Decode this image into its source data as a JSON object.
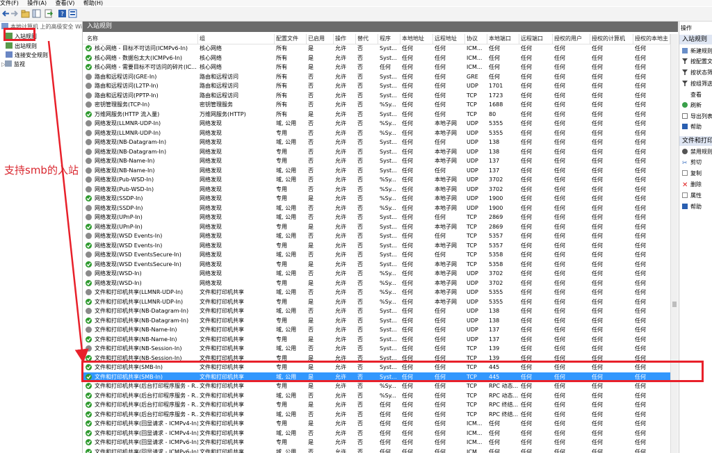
{
  "menu": [
    "文件(F)",
    "操作(A)",
    "查看(V)",
    "帮助(H)"
  ],
  "tree": {
    "root": "本地计算机 上的高级安全 Wi",
    "items": [
      "入站规则",
      "出站规则",
      "连接安全规则",
      "监视"
    ]
  },
  "pane_title": "入站规则",
  "columns": [
    "名称",
    "组",
    "配置文件",
    "已启用",
    "操作",
    "替代",
    "程序",
    "本地地址",
    "远程地址",
    "协议",
    "本地端口",
    "远程端口",
    "授权的用户",
    "授权的计算机",
    "授权的本地主"
  ],
  "rows": [
    {
      "s": "en",
      "c": [
        "核心网络 - 目标不可访问(ICMPv6-In)",
        "核心网络",
        "所有",
        "是",
        "允许",
        "否",
        "Syst...",
        "任何",
        "任何",
        "ICM...",
        "任何",
        "任何",
        "任何",
        "任何",
        "任何"
      ]
    },
    {
      "s": "en",
      "c": [
        "核心网络 - 数据包太大(ICMPv6-In)",
        "核心网络",
        "所有",
        "是",
        "允许",
        "否",
        "Syst...",
        "任何",
        "任何",
        "ICM...",
        "任何",
        "任何",
        "任何",
        "任何",
        "任何"
      ]
    },
    {
      "s": "en",
      "c": [
        "核心网络 - 需要目标不可访问的碎片(IC...",
        "核心网络",
        "所有",
        "是",
        "允许",
        "否",
        "任何",
        "任何",
        "任何",
        "ICM...",
        "任何",
        "任何",
        "任何",
        "任何",
        "任何"
      ]
    },
    {
      "s": "dis",
      "c": [
        "路由和远程访问(GRE-In)",
        "路由和远程访问",
        "所有",
        "否",
        "允许",
        "否",
        "Syst...",
        "任何",
        "任何",
        "GRE",
        "任何",
        "任何",
        "任何",
        "任何",
        "任何"
      ]
    },
    {
      "s": "dis",
      "c": [
        "路由和远程访问(L2TP-In)",
        "路由和远程访问",
        "所有",
        "否",
        "允许",
        "否",
        "Syst...",
        "任何",
        "任何",
        "UDP",
        "1701",
        "任何",
        "任何",
        "任何",
        "任何"
      ]
    },
    {
      "s": "dis",
      "c": [
        "路由和远程访问(PPTP-In)",
        "路由和远程访问",
        "所有",
        "否",
        "允许",
        "否",
        "Syst...",
        "任何",
        "任何",
        "TCP",
        "1723",
        "任何",
        "任何",
        "任何",
        "任何"
      ]
    },
    {
      "s": "dis",
      "c": [
        "密钥管理服务(TCP-In)",
        "密钥管理服务",
        "所有",
        "否",
        "允许",
        "否",
        "%Sy...",
        "任何",
        "任何",
        "TCP",
        "1688",
        "任何",
        "任何",
        "任何",
        "任何"
      ]
    },
    {
      "s": "en",
      "c": [
        "万维网服务(HTTP 流入量)",
        "万维网服务(HTTP)",
        "所有",
        "是",
        "允许",
        "否",
        "Syst...",
        "任何",
        "任何",
        "TCP",
        "80",
        "任何",
        "任何",
        "任何",
        "任何"
      ]
    },
    {
      "s": "dis",
      "c": [
        "网络发现(LLMNR-UDP-In)",
        "网络发现",
        "域, 公用",
        "否",
        "允许",
        "否",
        "%Sy...",
        "任何",
        "本地子网",
        "UDP",
        "5355",
        "任何",
        "任何",
        "任何",
        "任何"
      ]
    },
    {
      "s": "dis",
      "c": [
        "网络发现(LLMNR-UDP-In)",
        "网络发现",
        "专用",
        "否",
        "允许",
        "否",
        "%Sy...",
        "任何",
        "本地子网",
        "UDP",
        "5355",
        "任何",
        "任何",
        "任何",
        "任何"
      ]
    },
    {
      "s": "dis",
      "c": [
        "网络发现(NB-Datagram-In)",
        "网络发现",
        "域, 公用",
        "否",
        "允许",
        "否",
        "Syst...",
        "任何",
        "任何",
        "UDP",
        "138",
        "任何",
        "任何",
        "任何",
        "任何"
      ]
    },
    {
      "s": "dis",
      "c": [
        "网络发现(NB-Datagram-In)",
        "网络发现",
        "专用",
        "否",
        "允许",
        "否",
        "Syst...",
        "任何",
        "本地子网",
        "UDP",
        "138",
        "任何",
        "任何",
        "任何",
        "任何"
      ]
    },
    {
      "s": "dis",
      "c": [
        "网络发现(NB-Name-In)",
        "网络发现",
        "专用",
        "否",
        "允许",
        "否",
        "Syst...",
        "任何",
        "本地子网",
        "UDP",
        "137",
        "任何",
        "任何",
        "任何",
        "任何"
      ]
    },
    {
      "s": "dis",
      "c": [
        "网络发现(NB-Name-In)",
        "网络发现",
        "域, 公用",
        "否",
        "允许",
        "否",
        "Syst...",
        "任何",
        "任何",
        "UDP",
        "137",
        "任何",
        "任何",
        "任何",
        "任何"
      ]
    },
    {
      "s": "dis",
      "c": [
        "网络发现(Pub-WSD-In)",
        "网络发现",
        "域, 公用",
        "否",
        "允许",
        "否",
        "%Sy...",
        "任何",
        "本地子网",
        "UDP",
        "3702",
        "任何",
        "任何",
        "任何",
        "任何"
      ]
    },
    {
      "s": "dis",
      "c": [
        "网络发现(Pub-WSD-In)",
        "网络发现",
        "专用",
        "否",
        "允许",
        "否",
        "%Sy...",
        "任何",
        "本地子网",
        "UDP",
        "3702",
        "任何",
        "任何",
        "任何",
        "任何"
      ]
    },
    {
      "s": "en",
      "c": [
        "网络发现(SSDP-In)",
        "网络发现",
        "专用",
        "是",
        "允许",
        "否",
        "%Sy...",
        "任何",
        "本地子网",
        "UDP",
        "1900",
        "任何",
        "任何",
        "任何",
        "任何"
      ]
    },
    {
      "s": "dis",
      "c": [
        "网络发现(SSDP-In)",
        "网络发现",
        "域, 公用",
        "否",
        "允许",
        "否",
        "%Sy...",
        "任何",
        "本地子网",
        "UDP",
        "1900",
        "任何",
        "任何",
        "任何",
        "任何"
      ]
    },
    {
      "s": "dis",
      "c": [
        "网络发现(UPnP-In)",
        "网络发现",
        "域, 公用",
        "否",
        "允许",
        "否",
        "Syst...",
        "任何",
        "任何",
        "TCP",
        "2869",
        "任何",
        "任何",
        "任何",
        "任何"
      ]
    },
    {
      "s": "en",
      "c": [
        "网络发现(UPnP-In)",
        "网络发现",
        "专用",
        "是",
        "允许",
        "否",
        "Syst...",
        "任何",
        "本地子网",
        "TCP",
        "2869",
        "任何",
        "任何",
        "任何",
        "任何"
      ]
    },
    {
      "s": "dis",
      "c": [
        "网络发现(WSD Events-In)",
        "网络发现",
        "域, 公用",
        "否",
        "允许",
        "否",
        "Syst...",
        "任何",
        "任何",
        "TCP",
        "5357",
        "任何",
        "任何",
        "任何",
        "任何"
      ]
    },
    {
      "s": "en",
      "c": [
        "网络发现(WSD Events-In)",
        "网络发现",
        "专用",
        "是",
        "允许",
        "否",
        "Syst...",
        "任何",
        "本地子网",
        "TCP",
        "5357",
        "任何",
        "任何",
        "任何",
        "任何"
      ]
    },
    {
      "s": "dis",
      "c": [
        "网络发现(WSD EventsSecure-In)",
        "网络发现",
        "域, 公用",
        "否",
        "允许",
        "否",
        "Syst...",
        "任何",
        "任何",
        "TCP",
        "5358",
        "任何",
        "任何",
        "任何",
        "任何"
      ]
    },
    {
      "s": "en",
      "c": [
        "网络发现(WSD EventsSecure-In)",
        "网络发现",
        "专用",
        "是",
        "允许",
        "否",
        "Syst...",
        "任何",
        "本地子网",
        "TCP",
        "5358",
        "任何",
        "任何",
        "任何",
        "任何"
      ]
    },
    {
      "s": "dis",
      "c": [
        "网络发现(WSD-In)",
        "网络发现",
        "域, 公用",
        "否",
        "允许",
        "否",
        "%Sy...",
        "任何",
        "本地子网",
        "UDP",
        "3702",
        "任何",
        "任何",
        "任何",
        "任何"
      ]
    },
    {
      "s": "en",
      "c": [
        "网络发现(WSD-In)",
        "网络发现",
        "专用",
        "是",
        "允许",
        "否",
        "%Sy...",
        "任何",
        "本地子网",
        "UDP",
        "3702",
        "任何",
        "任何",
        "任何",
        "任何"
      ]
    },
    {
      "s": "dis",
      "c": [
        "文件和打印机共享(LLMNR-UDP-In)",
        "文件和打印机共享",
        "域, 公用",
        "否",
        "允许",
        "否",
        "%Sy...",
        "任何",
        "本地子网",
        "UDP",
        "5355",
        "任何",
        "任何",
        "任何",
        "任何"
      ]
    },
    {
      "s": "en",
      "c": [
        "文件和打印机共享(LLMNR-UDP-In)",
        "文件和打印机共享",
        "专用",
        "是",
        "允许",
        "否",
        "%Sy...",
        "任何",
        "本地子网",
        "UDP",
        "5355",
        "任何",
        "任何",
        "任何",
        "任何"
      ]
    },
    {
      "s": "dis",
      "c": [
        "文件和打印机共享(NB-Datagram-In)",
        "文件和打印机共享",
        "域, 公用",
        "否",
        "允许",
        "否",
        "Syst...",
        "任何",
        "任何",
        "UDP",
        "138",
        "任何",
        "任何",
        "任何",
        "任何"
      ]
    },
    {
      "s": "en",
      "c": [
        "文件和打印机共享(NB-Datagram-In)",
        "文件和打印机共享",
        "专用",
        "是",
        "允许",
        "否",
        "Syst...",
        "任何",
        "任何",
        "UDP",
        "138",
        "任何",
        "任何",
        "任何",
        "任何"
      ]
    },
    {
      "s": "dis",
      "c": [
        "文件和打印机共享(NB-Name-In)",
        "文件和打印机共享",
        "域, 公用",
        "否",
        "允许",
        "否",
        "Syst...",
        "任何",
        "任何",
        "UDP",
        "137",
        "任何",
        "任何",
        "任何",
        "任何"
      ]
    },
    {
      "s": "en",
      "c": [
        "文件和打印机共享(NB-Name-In)",
        "文件和打印机共享",
        "专用",
        "是",
        "允许",
        "否",
        "Syst...",
        "任何",
        "任何",
        "UDP",
        "137",
        "任何",
        "任何",
        "任何",
        "任何"
      ]
    },
    {
      "s": "dis",
      "c": [
        "文件和打印机共享(NB-Session-In)",
        "文件和打印机共享",
        "域, 公用",
        "否",
        "允许",
        "否",
        "Syst...",
        "任何",
        "任何",
        "TCP",
        "139",
        "任何",
        "任何",
        "任何",
        "任何"
      ]
    },
    {
      "s": "en",
      "c": [
        "文件和打印机共享(NB-Session-In)",
        "文件和打印机共享",
        "专用",
        "是",
        "允许",
        "否",
        "Syst...",
        "任何",
        "任何",
        "TCP",
        "139",
        "任何",
        "任何",
        "任何",
        "任何"
      ]
    },
    {
      "s": "en",
      "c": [
        "文件和打印机共享(SMB-In)",
        "文件和打印机共享",
        "专用",
        "是",
        "允许",
        "否",
        "Syst...",
        "任何",
        "任何",
        "TCP",
        "445",
        "任何",
        "任何",
        "任何",
        "任何"
      ]
    },
    {
      "s": "en",
      "sel": true,
      "c": [
        "文件和打印机共享(SMB-In)",
        "文件和打印机共享",
        "域, 公用",
        "是",
        "允许",
        "否",
        "Syst...",
        "任何",
        "任何",
        "TCP",
        "445",
        "任何",
        "任何",
        "任何",
        "任何"
      ]
    },
    {
      "s": "en",
      "c": [
        "文件和打印机共享(后台打印程序服务 - R...",
        "文件和打印机共享",
        "专用",
        "是",
        "允许",
        "否",
        "%Sy...",
        "任何",
        "任何",
        "TCP",
        "RPC 动态...",
        "任何",
        "任何",
        "任何",
        "任何"
      ]
    },
    {
      "s": "en",
      "c": [
        "文件和打印机共享(后台打印程序服务 - R...",
        "文件和打印机共享",
        "域, 公用",
        "否",
        "允许",
        "否",
        "%Sy...",
        "任何",
        "任何",
        "TCP",
        "RPC 动态...",
        "任何",
        "任何",
        "任何",
        "任何"
      ]
    },
    {
      "s": "en",
      "c": [
        "文件和打印机共享(后台打印程序服务 - R...",
        "文件和打印机共享",
        "专用",
        "是",
        "允许",
        "否",
        "任何",
        "任何",
        "任何",
        "TCP",
        "RPC 终结...",
        "任何",
        "任何",
        "任何",
        "任何"
      ]
    },
    {
      "s": "en",
      "c": [
        "文件和打印机共享(后台打印程序服务 - R...",
        "文件和打印机共享",
        "域, 公用",
        "否",
        "允许",
        "否",
        "任何",
        "任何",
        "任何",
        "TCP",
        "RPC 终结...",
        "任何",
        "任何",
        "任何",
        "任何"
      ]
    },
    {
      "s": "en",
      "c": [
        "文件和打印机共享(回显请求 - ICMPv4-In)",
        "文件和打印机共享",
        "专用",
        "是",
        "允许",
        "否",
        "任何",
        "任何",
        "任何",
        "ICM...",
        "任何",
        "任何",
        "任何",
        "任何",
        "任何"
      ]
    },
    {
      "s": "en",
      "c": [
        "文件和打印机共享(回显请求 - ICMPv4-In)",
        "文件和打印机共享",
        "域, 公用",
        "否",
        "允许",
        "否",
        "任何",
        "任何",
        "任何",
        "ICM...",
        "任何",
        "任何",
        "任何",
        "任何",
        "任何"
      ]
    },
    {
      "s": "en",
      "c": [
        "文件和打印机共享(回显请求 - ICMPv6-In)",
        "文件和打印机共享",
        "专用",
        "是",
        "允许",
        "否",
        "任何",
        "任何",
        "任何",
        "ICM...",
        "任何",
        "任何",
        "任何",
        "任何",
        "任何"
      ]
    },
    {
      "s": "en",
      "c": [
        "文件和打印机共享(回显请求 - ICMPv6-In)",
        "文件和打印机共享",
        "域, 公用",
        "否",
        "允许",
        "否",
        "任何",
        "任何",
        "任何",
        "ICM...",
        "任何",
        "任何",
        "任何",
        "任何",
        "任何"
      ]
    }
  ],
  "actions": {
    "title": "操作",
    "section1": "入站规则",
    "items1": [
      "新建规则",
      "按配置文",
      "按状态筛",
      "按组筛选",
      "查看",
      "刷新",
      "导出列表",
      "帮助"
    ],
    "section2": "文件和打印",
    "items2": [
      "禁用规则",
      "剪切",
      "复制",
      "删除",
      "属性",
      "帮助"
    ]
  },
  "annotation": "支持smb的入站",
  "colors": {
    "highlight": "#e8202a",
    "selection": "#3297fd",
    "enabled": "#2e9a2e",
    "disabled": "#8a8a8a"
  }
}
